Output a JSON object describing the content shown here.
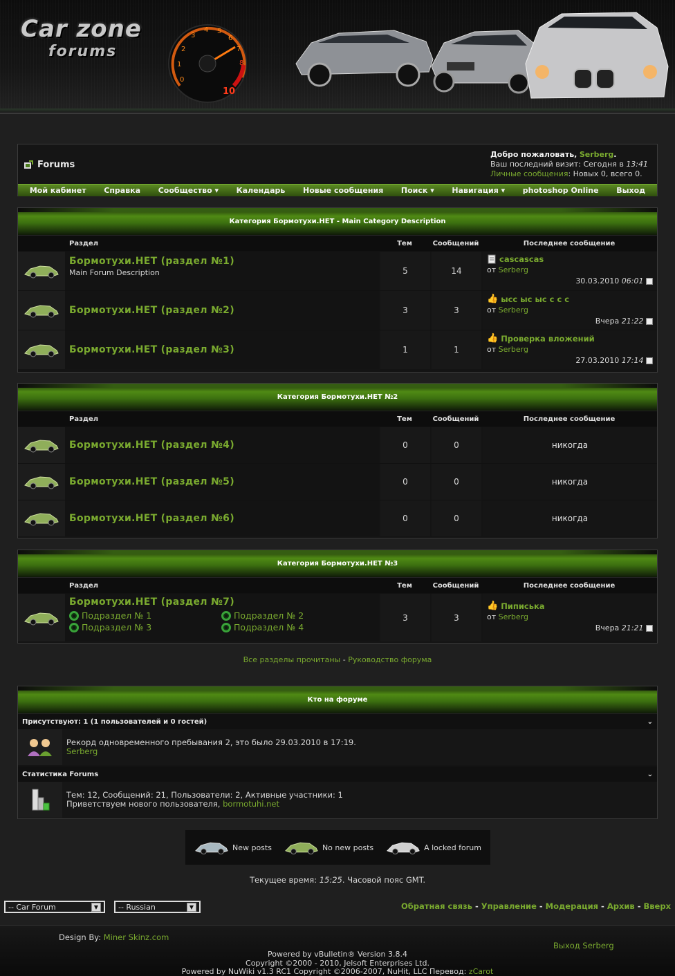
{
  "header": {
    "logo_line1": "Car zone",
    "logo_line2": "forums"
  },
  "topbox": {
    "crumb": "Forums",
    "welcome_prefix": "Добро пожаловать,",
    "username": "Serberg",
    "last_visit_label": "Ваш последний визит: Сегодня в",
    "last_visit_time": "13:41",
    "pm_link": "Личные сообщения",
    "pm_counts": ": Новых 0, всего 0."
  },
  "nav": [
    "Мой кабинет",
    "Справка",
    "Сообщество ▾",
    "Календарь",
    "Новые сообщения",
    "Поиск ▾",
    "Навигация ▾",
    "photoshop Online",
    "Выход"
  ],
  "columns": {
    "forum": "Раздел",
    "threads": "Тем",
    "posts": "Сообщений",
    "last": "Последнее сообщение"
  },
  "categories": [
    {
      "title": "Категория Бормотухи.НЕТ - Main Category Description",
      "forums": [
        {
          "title": "Бормотухи.НЕТ (раздел №1)",
          "desc": "Main Forum Description",
          "threads": "5",
          "posts": "14",
          "last_title": "cascascas",
          "by_label": "от",
          "by": "Serberg",
          "date": "30.03.2010",
          "time": "06:01",
          "icon": "doc-icon"
        },
        {
          "title": "Бормотухи.НЕТ (раздел №2)",
          "desc": "",
          "threads": "3",
          "posts": "3",
          "last_title": "ысс ыс ыс с с с",
          "by_label": "от",
          "by": "Serberg",
          "date": "Вчера",
          "time": "21:22",
          "icon": "thumbs-up-icon"
        },
        {
          "title": "Бормотухи.НЕТ (раздел №3)",
          "desc": "",
          "threads": "1",
          "posts": "1",
          "last_title": "Проверка вложений",
          "by_label": "от",
          "by": "Serberg",
          "date": "27.03.2010",
          "time": "17:14",
          "icon": "thumbs-up-icon"
        }
      ]
    },
    {
      "title": "Категория Бормотухи.НЕТ №2",
      "forums": [
        {
          "title": "Бормотухи.НЕТ (раздел №4)",
          "threads": "0",
          "posts": "0",
          "never": "никогда"
        },
        {
          "title": "Бормотухи.НЕТ (раздел №5)",
          "threads": "0",
          "posts": "0",
          "never": "никогда"
        },
        {
          "title": "Бормотухи.НЕТ (раздел №6)",
          "threads": "0",
          "posts": "0",
          "never": "никогда"
        }
      ]
    },
    {
      "title": "Категория Бормотухи.НЕТ №3",
      "forums": [
        {
          "title": "Бормотухи.НЕТ (раздел №7)",
          "threads": "3",
          "posts": "3",
          "last_title": "Пиписька",
          "by_label": "от",
          "by": "Serberg",
          "date": "Вчера",
          "time": "21:21",
          "subforums": [
            "Подраздел № 1",
            "Подраздел № 2",
            "Подраздел № 3",
            "Подраздел № 4"
          ]
        }
      ]
    }
  ],
  "links": {
    "mark_read": "Все разделы прочитаны",
    "sep": " - ",
    "guide": "Руководство форума"
  },
  "whosonline": {
    "title": "Кто на форуме",
    "present": "Присутствуют: 1 (1 пользователей и 0 гостей)",
    "record": "Рекорд одновременного пребывания 2, это было 29.03.2010 в 17:19.",
    "user": "Serberg",
    "stats_title": "Статистика Forums",
    "stats": "Тем: 12, Сообщений: 21, Пользователи: 2, Активные участники: 1",
    "welcome_new": "Приветствуем нового пользователя,",
    "new_user": "bormotuhi.net"
  },
  "legend": {
    "new": "New posts",
    "nonew": "No new posts",
    "locked": "A locked forum"
  },
  "time": {
    "label": "Текущее время:",
    "value": "15:25",
    "tz": ". Часовой пояс GMT."
  },
  "selects": {
    "style": "-- Car Forum",
    "lang": "-- Russian"
  },
  "bottom_links": [
    "Обратная связь",
    "Управление",
    "Модерация",
    "Архив",
    "Вверх"
  ],
  "footer": {
    "design_label": "Design By:",
    "design_link": "Miner Skinz.com",
    "logout": "Выход Serberg",
    "powered1": "Powered by vBulletin® Version 3.8.4",
    "powered2": "Copyright ©2000 - 2010, Jelsoft Enterprises Ltd.",
    "powered3": "Powered by NuWiki v1.3 RC1 Copyright ©2006-2007, NuHit, LLC Перевод:",
    "translator": "zCarot"
  },
  "colors": {
    "accent": "#7aaa2f",
    "nav_green": "#4f8a14"
  }
}
